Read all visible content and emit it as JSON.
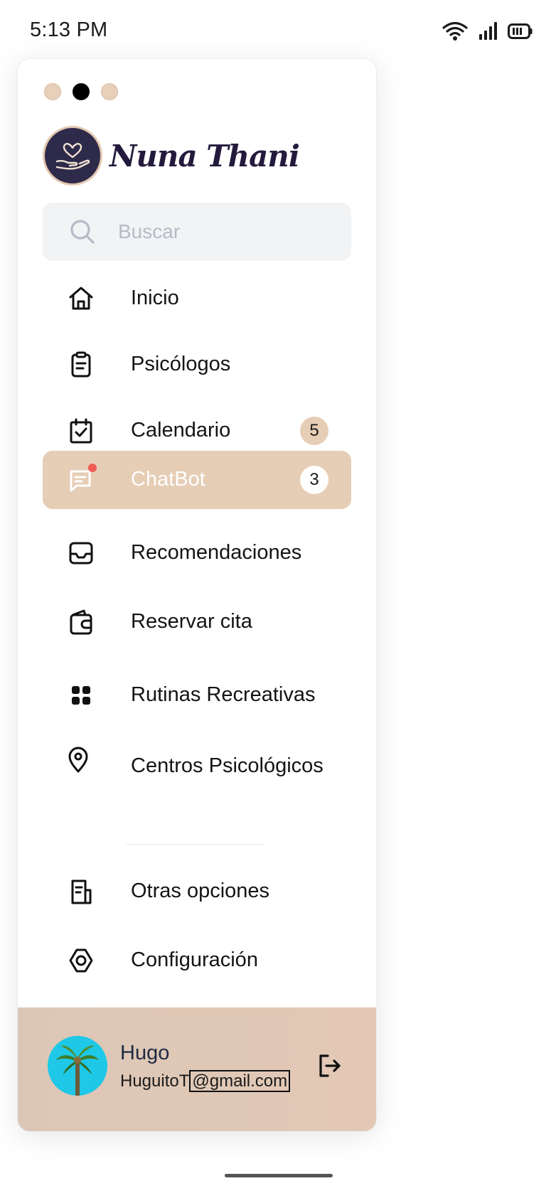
{
  "status_bar": {
    "time": "5:13 PM",
    "icons": [
      "wifi-icon",
      "signal-icon",
      "battery-icon"
    ]
  },
  "window_dots": [
    "dot",
    "dot-active",
    "dot"
  ],
  "brand": {
    "name": "Nuna Thani",
    "logo_icon": "heart-in-hand-icon",
    "colors": {
      "logo_bg": "#2e2a4a",
      "accent": "#e6cdb5"
    }
  },
  "search": {
    "placeholder": "Buscar",
    "icon": "search-icon"
  },
  "nav": {
    "items": [
      {
        "label": "Inicio",
        "icon": "home-icon"
      },
      {
        "label": "Psicólogos",
        "icon": "clipboard-icon"
      },
      {
        "label": "Calendario",
        "icon": "calendar-check-icon",
        "badge": "5"
      },
      {
        "label": "ChatBot",
        "icon": "chat-icon",
        "badge": "3",
        "active": true
      },
      {
        "label": "Recomendaciones",
        "icon": "inbox-icon"
      },
      {
        "label": "Reservar cita",
        "icon": "wallet-icon"
      },
      {
        "label": "Rutinas Recreativas",
        "icon": "grid-icon"
      },
      {
        "label": "Centros Psicológicos",
        "icon": "location-pin-icon"
      },
      {
        "label": "Otras opciones",
        "icon": "document-icon"
      },
      {
        "label": "Configuración",
        "icon": "settings-icon"
      }
    ]
  },
  "user": {
    "name": "Hugo",
    "email_prefix": "HuguitoT",
    "email_domain": "@gmail.com",
    "avatar_icon": "palm-tree-avatar",
    "logout_icon": "logout-icon"
  }
}
